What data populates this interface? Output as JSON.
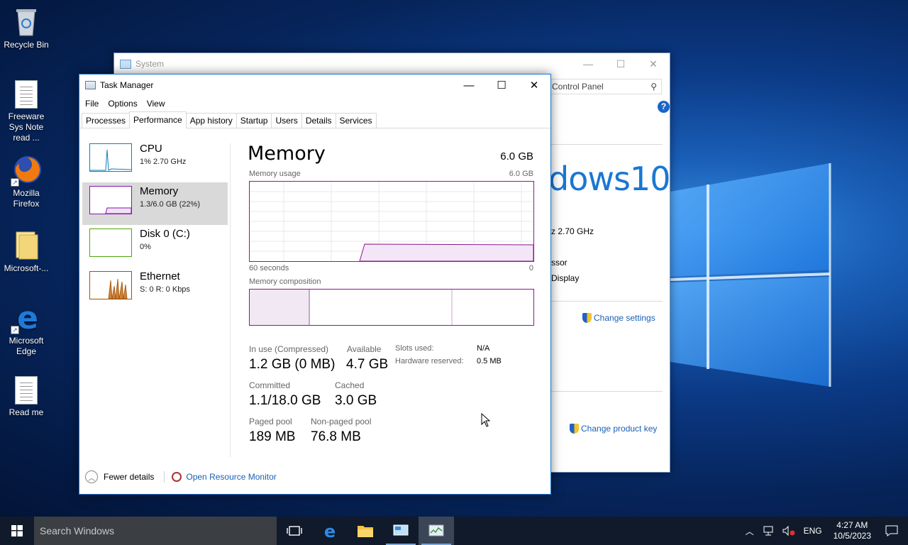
{
  "desktop": {
    "icons": [
      {
        "label": "Recycle Bin",
        "icon": "recycle-bin-icon"
      },
      {
        "label": "Freeware Sys Note read ...",
        "icon": "text-document-icon"
      },
      {
        "label": "Mozilla Firefox",
        "icon": "firefox-icon"
      },
      {
        "label": "Microsoft-...",
        "icon": "folder-icon"
      },
      {
        "label": "Microsoft Edge",
        "icon": "edge-icon"
      },
      {
        "label": "Read me",
        "icon": "text-document-icon"
      }
    ]
  },
  "system_window": {
    "title": "System",
    "search_placeholder": "Control Panel",
    "brand": "dows10",
    "processor_speed": "z  2.70 GHz",
    "system_type": "ssor",
    "pen_touch": "Display",
    "change_settings": "Change settings",
    "change_product_key": "Change product key"
  },
  "task_manager": {
    "title": "Task Manager",
    "menu": [
      "File",
      "Options",
      "View"
    ],
    "tabs": [
      "Processes",
      "Performance",
      "App history",
      "Startup",
      "Users",
      "Details",
      "Services"
    ],
    "active_tab": "Performance",
    "resources": [
      {
        "name": "CPU",
        "value": "1% 2.70 GHz",
        "color": "#117dbb"
      },
      {
        "name": "Memory",
        "value": "1.3/6.0 GB (22%)",
        "color": "#8b12ae"
      },
      {
        "name": "Disk 0 (C:)",
        "value": "0%",
        "color": "#4da60c"
      },
      {
        "name": "Ethernet",
        "value": "S: 0 R: 0 Kbps",
        "color": "#a74f01"
      }
    ],
    "memory": {
      "title": "Memory",
      "total": "6.0 GB",
      "usage_label": "Memory usage",
      "usage_max": "6.0 GB",
      "time_left": "60 seconds",
      "time_right": "0",
      "composition_label": "Memory composition",
      "in_use_label": "In use (Compressed)",
      "in_use_value": "1.2 GB (0 MB)",
      "available_label": "Available",
      "available_value": "4.7 GB",
      "slots_label": "Slots used:",
      "slots_value": "N/A",
      "hw_reserved_label": "Hardware reserved:",
      "hw_reserved_value": "0.5 MB",
      "committed_label": "Committed",
      "committed_value": "1.1/18.0 GB",
      "cached_label": "Cached",
      "cached_value": "3.0 GB",
      "paged_label": "Paged pool",
      "paged_value": "189 MB",
      "nonpaged_label": "Non-paged pool",
      "nonpaged_value": "76.8 MB"
    },
    "footer": {
      "fewer_details": "Fewer details",
      "open_resource_monitor": "Open Resource Monitor"
    }
  },
  "taskbar": {
    "search_placeholder": "Search Windows",
    "language": "ENG",
    "time": "4:27 AM",
    "date": "10/5/2023"
  },
  "colors": {
    "accent": "#1a78d0",
    "memory_purple": "#8b188b",
    "taskbar": "#101a2a"
  }
}
